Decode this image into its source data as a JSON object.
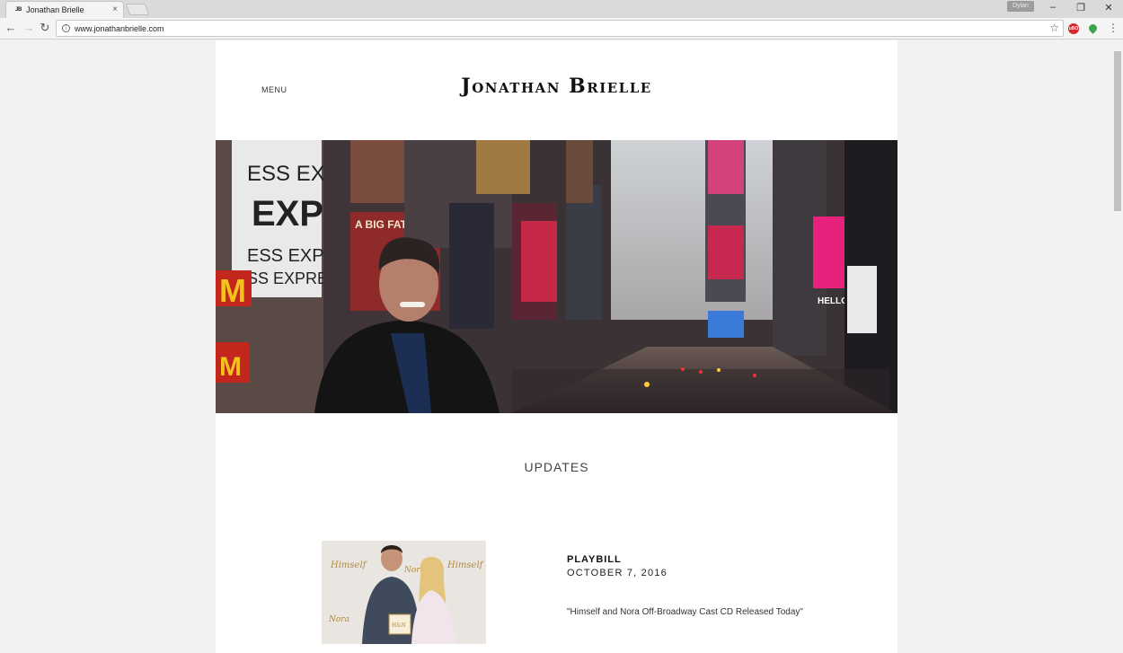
{
  "browser": {
    "tab_title": "Jonathan Brielle",
    "tab_favicon": "JB",
    "tab_close": "×",
    "profile_label": "Dylan",
    "url": "www.jonathanbrielle.com",
    "icons": {
      "back": "back-arrow-icon",
      "forward": "forward-arrow-icon",
      "reload": "reload-icon",
      "info": "info-icon",
      "bookmark": "star-icon",
      "ext1": "ublock-icon",
      "ext2": "location-pin-icon",
      "menu": "kebab-menu-icon"
    },
    "window_controls": {
      "minimize": "–",
      "restore": "❐",
      "close": "✕"
    },
    "ext1_label": "uBO"
  },
  "site": {
    "menu_label": "MENU",
    "logo": "Jonathan Brielle",
    "hero_alt": "Jonathan Brielle in Times Square",
    "section_title": "UPDATES",
    "posts": [
      {
        "source": "PLAYBILL",
        "date": "OCTOBER 7, 2016",
        "title": "\"Himself and Nora Off-Broadway Cast CD Released Today\""
      }
    ]
  },
  "colors": {
    "page_bg": "#f2f2f2",
    "content_bg": "#ffffff",
    "text": "#222222"
  }
}
